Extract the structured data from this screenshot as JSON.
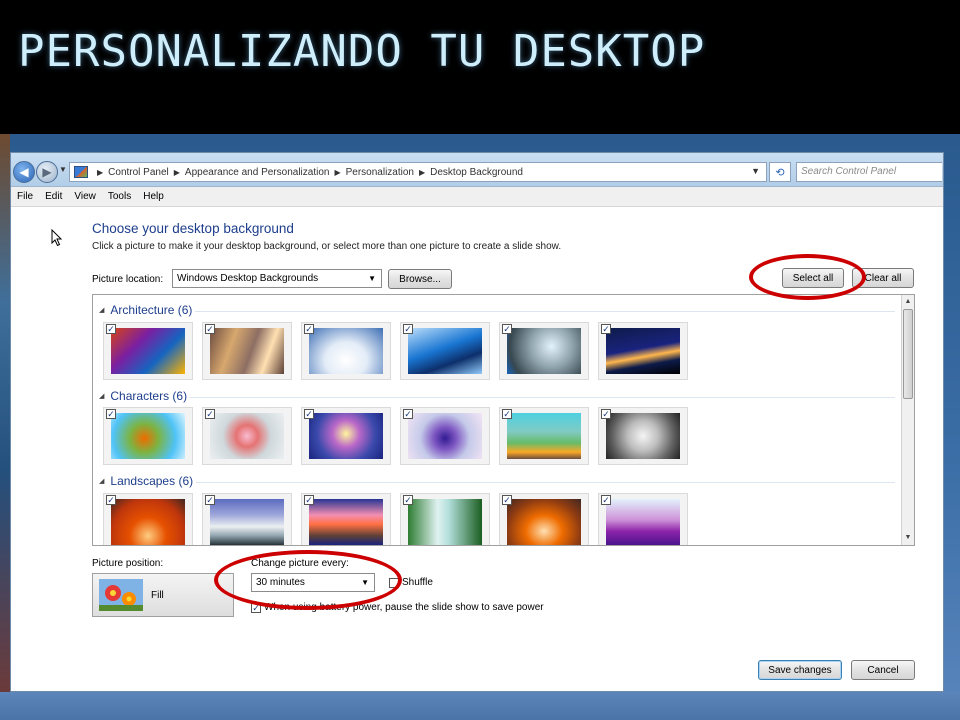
{
  "slide": {
    "title": "PERSONALIZANDO TU DESKTOP"
  },
  "window": {
    "breadcrumb": [
      "Control Panel",
      "Appearance and Personalization",
      "Personalization",
      "Desktop Background"
    ],
    "search_placeholder": "Search Control Panel",
    "menu": [
      "File",
      "Edit",
      "View",
      "Tools",
      "Help"
    ]
  },
  "page": {
    "heading": "Choose your desktop background",
    "subtext": "Click a picture to make it your desktop background, or select more than one picture to create a slide show.",
    "picture_location_label": "Picture location:",
    "picture_location_value": "Windows Desktop Backgrounds",
    "browse_label": "Browse...",
    "select_all_label": "Select all",
    "clear_all_label": "Clear all"
  },
  "gallery": {
    "groups": [
      {
        "label": "Architecture (6)",
        "count": 6
      },
      {
        "label": "Characters (6)",
        "count": 6
      },
      {
        "label": "Landscapes (6)",
        "count": 6
      }
    ]
  },
  "options": {
    "picture_position_label": "Picture position:",
    "picture_position_value": "Fill",
    "change_picture_label": "Change picture every:",
    "change_picture_value": "30 minutes",
    "shuffle_label": "Shuffle",
    "shuffle_checked": false,
    "battery_label": "When using battery power, pause the slide show to save power",
    "battery_checked": true
  },
  "actions": {
    "save_label": "Save changes",
    "cancel_label": "Cancel"
  },
  "colors": {
    "annotation": "#cc0000",
    "heading": "#1d3e8c",
    "title": "#cfeefc"
  }
}
